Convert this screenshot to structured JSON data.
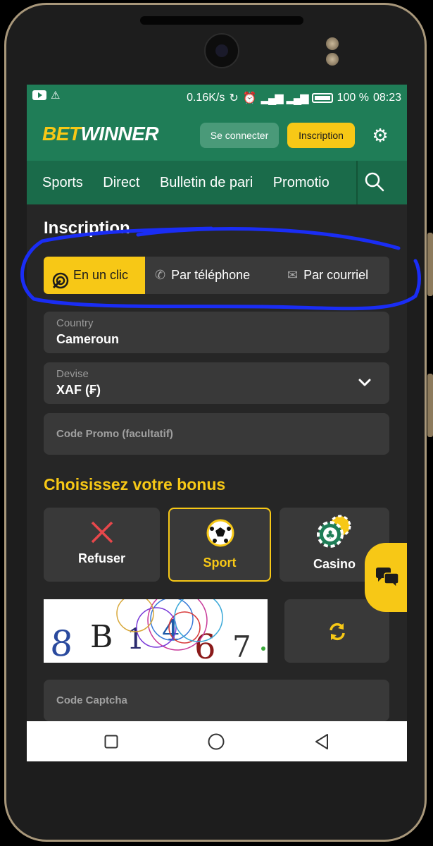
{
  "status_bar": {
    "net_speed": "0.16K/s",
    "battery": "100 %",
    "time": "08:23"
  },
  "header": {
    "logo_part1": "BET",
    "logo_part2": "WINNER",
    "login_label": "Se connecter",
    "register_label": "Inscription"
  },
  "nav": {
    "items": [
      "Sports",
      "Direct",
      "Bulletin de pari",
      "Promotio"
    ]
  },
  "page": {
    "title": "Inscription"
  },
  "tabs": [
    {
      "label": "En un clic"
    },
    {
      "label": "Par téléphone"
    },
    {
      "label": "Par courriel"
    }
  ],
  "form": {
    "country_label": "Country",
    "country_value": "Cameroun",
    "currency_label": "Devise",
    "currency_value": "XAF (₣)",
    "promo_placeholder": "Code Promo (facultatif)",
    "captcha_placeholder": "Code Captcha"
  },
  "bonus": {
    "title": "Choisissez votre bonus",
    "options": [
      {
        "label": "Refuser"
      },
      {
        "label": "Sport"
      },
      {
        "label": "Casino"
      }
    ]
  },
  "captcha": {
    "text": "8B1467"
  },
  "colors": {
    "brand_green": "#1f7d57",
    "accent_yellow": "#f7c816",
    "annotation_blue": "#1a2df5"
  }
}
